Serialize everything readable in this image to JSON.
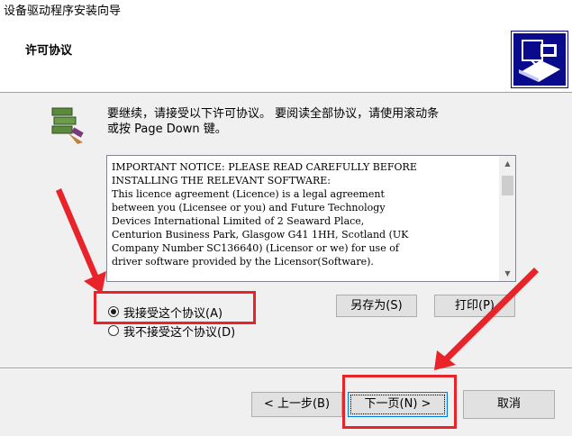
{
  "window": {
    "title": "设备驱动程序安装向导"
  },
  "header": {
    "title": "许可协议",
    "logo_icon": "installer-logo-icon"
  },
  "intro": {
    "line1": "要继续，请接受以下许可协议。 要阅读全部协议，请使用滚动条",
    "line2": "或按 Page Down 键。"
  },
  "license": {
    "text": "IMPORTANT NOTICE: PLEASE READ CAREFULLY BEFORE\nINSTALLING THE RELEVANT SOFTWARE:\nThis licence agreement (Licence) is a legal agreement\nbetween you (Licensee or you) and Future Technology\nDevices International Limited of 2 Seaward Place,\nCenturion Business Park, Glasgow G41 1HH, Scotland (UK\nCompany Number SC136640) (Licensor or we) for use of\ndriver software provided by the Licensor(Software)."
  },
  "options": {
    "accept": {
      "label": "我接受这个协议(A)",
      "selected": true
    },
    "decline": {
      "label": "我不接受这个协议(D)",
      "selected": false
    }
  },
  "buttons": {
    "save_as": "另存为(S)",
    "print": "打印(P)",
    "back": "< 上一步(B)",
    "next": "下一页(N) >",
    "cancel": "取消"
  },
  "annotation_colors": {
    "highlight": "#e8242a"
  }
}
